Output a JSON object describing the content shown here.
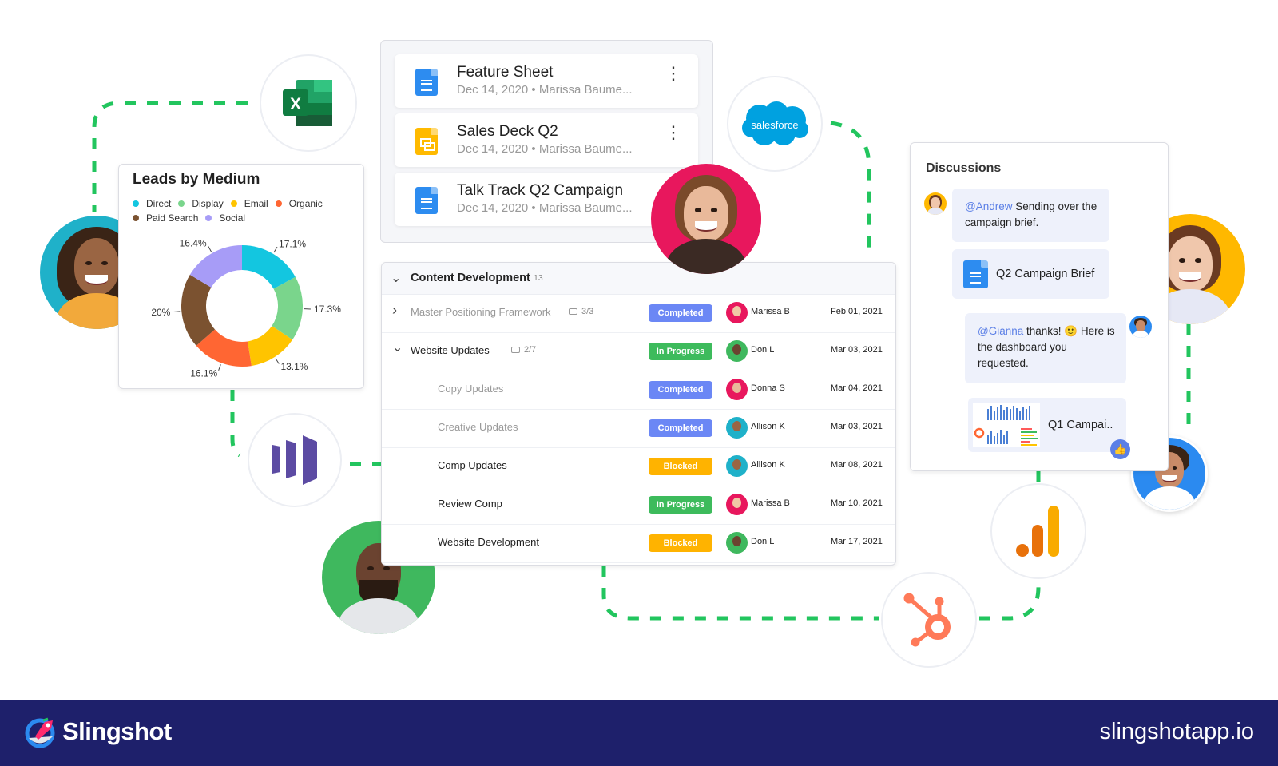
{
  "leads_chart": {
    "title": "Leads by Medium",
    "legend": [
      {
        "label": "Direct",
        "color": "#13c6e0"
      },
      {
        "label": "Display",
        "color": "#7ad58c"
      },
      {
        "label": "Email",
        "color": "#ffc400"
      },
      {
        "label": "Organic",
        "color": "#ff6633"
      },
      {
        "label": "Paid Search",
        "color": "#7b5230"
      },
      {
        "label": "Social",
        "color": "#a79cf7"
      }
    ]
  },
  "chart_data": {
    "type": "pie",
    "title": "Leads by Medium",
    "donut": true,
    "categories": [
      "Direct",
      "Display",
      "Email",
      "Organic",
      "Paid Search",
      "Social"
    ],
    "values": [
      17.1,
      17.3,
      13.1,
      16.1,
      20,
      16.4
    ],
    "labels": [
      "17.1%",
      "17.3%",
      "13.1%",
      "16.1%",
      "20%",
      "16.4%"
    ],
    "colors": [
      "#13c6e0",
      "#7ad58c",
      "#ffc400",
      "#ff6633",
      "#7b5230",
      "#a79cf7"
    ],
    "legend_position": "top-left"
  },
  "documents": [
    {
      "title": "Feature Sheet",
      "subtitle": "Dec 14, 2020 • Marissa Baume...",
      "type": "doc",
      "color": "#2d8cf0",
      "menu": "⋮"
    },
    {
      "title": "Sales Deck Q2",
      "subtitle": "Dec 14, 2020 • Marissa Baume...",
      "type": "slides",
      "color": "#ffba00",
      "menu": "⋮"
    },
    {
      "title": "Talk Track Q2 Campaign",
      "subtitle": "Dec 14, 2020 • Marissa Baume...",
      "type": "doc",
      "color": "#2d8cf0"
    }
  ],
  "tasks": {
    "group_title": "Content Development",
    "group_count": "13",
    "rows": [
      {
        "name": "Master Positioning Framework",
        "expander": "›",
        "subtasks": "3/3",
        "status": "Completed",
        "assignee": "Marissa B",
        "date": "Feb 01, 2021",
        "muted": true
      },
      {
        "name": "Website Updates",
        "expander": "⌄",
        "subtasks": "2/7",
        "status": "In Progress",
        "assignee": "Don L",
        "date": "Mar 03, 2021",
        "muted": false
      },
      {
        "name": "Copy Updates",
        "status": "Completed",
        "assignee": "Donna S",
        "date": "Mar 04, 2021",
        "muted": true
      },
      {
        "name": "Creative Updates",
        "status": "Completed",
        "assignee": "Allison K",
        "date": "Mar 03, 2021",
        "muted": true
      },
      {
        "name": "Comp Updates",
        "status": "Blocked",
        "assignee": "Allison K",
        "date": "Mar 08, 2021",
        "muted": false
      },
      {
        "name": "Review Comp",
        "status": "In Progress",
        "assignee": "Marissa B",
        "date": "Mar 10, 2021",
        "muted": false
      },
      {
        "name": "Website Development",
        "status": "Blocked",
        "assignee": "Don L",
        "date": "Mar 17, 2021",
        "muted": false
      }
    ],
    "status_colors": {
      "Completed": "#6b87f5",
      "In Progress": "#3dbb5c",
      "Blocked": "#ffb300"
    }
  },
  "discussions": {
    "title": "Discussions",
    "messages": [
      {
        "mention": "@Andrew",
        "text": " Sending over the campaign brief."
      },
      {
        "attachment": "Q2 Campaign Brief"
      },
      {
        "mention": "@Gianna",
        "text": " thanks! 🙂 Here is the dashboard you requested."
      },
      {
        "attachment": "Q1 Campai.."
      }
    ],
    "reaction": "thumbs-up"
  },
  "integrations": {
    "excel": "X",
    "salesforce": "salesforce"
  },
  "footer": {
    "brand": "Slingshot",
    "url": "slingshotapp.io"
  },
  "colors": {
    "connector": "#22c55e",
    "footer_bg": "#1e206b",
    "mention": "#5b7fe6"
  }
}
